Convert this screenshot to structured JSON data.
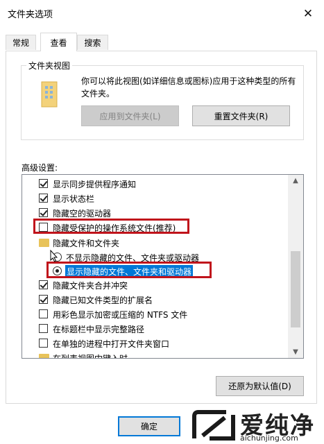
{
  "window": {
    "title": "文件夹选项"
  },
  "tabs": [
    {
      "label": "常规"
    },
    {
      "label": "查看"
    },
    {
      "label": "搜索"
    }
  ],
  "folder_views": {
    "group_label": "文件夹视图",
    "description": "你可以将此视图(如详细信息或图标)应用于这种类型的所有文件夹。",
    "apply_button": "应用到文件夹(L)",
    "reset_button": "重置文件夹(R)"
  },
  "advanced": {
    "label": "高级设置:",
    "items": [
      {
        "type": "checkbox",
        "checked": true,
        "label": "显示同步提供程序通知"
      },
      {
        "type": "checkbox",
        "checked": true,
        "label": "显示状态栏"
      },
      {
        "type": "checkbox",
        "checked": true,
        "label": "隐藏空的驱动器"
      },
      {
        "type": "checkbox",
        "checked": false,
        "label": "隐藏受保护的操作系统文件(推荐)"
      },
      {
        "type": "folder",
        "label": "隐藏文件和文件夹"
      },
      {
        "type": "radio",
        "checked": false,
        "label": "不显示隐藏的文件、文件夹或驱动器"
      },
      {
        "type": "radio",
        "checked": true,
        "label": "显示隐藏的文件、文件夹和驱动器"
      },
      {
        "type": "checkbox",
        "checked": true,
        "label": "隐藏文件夹合并冲突"
      },
      {
        "type": "checkbox",
        "checked": true,
        "label": "隐藏已知文件类型的扩展名"
      },
      {
        "type": "checkbox",
        "checked": false,
        "label": "用彩色显示加密或压缩的 NTFS 文件"
      },
      {
        "type": "checkbox",
        "checked": false,
        "label": "在标题栏中显示完整路径"
      },
      {
        "type": "checkbox",
        "checked": false,
        "label": "在单独的进程中打开文件夹窗口"
      },
      {
        "type": "folder",
        "label": "在列表视图中键入时"
      }
    ],
    "restore_button": "还原为默认值(D)"
  },
  "footer": {
    "ok_button": "确定"
  },
  "watermark": {
    "brand": "爱纯净",
    "url": "aichunjing.com"
  },
  "colors": {
    "highlight_box": "#c0131b",
    "selection": "#0078d7"
  }
}
